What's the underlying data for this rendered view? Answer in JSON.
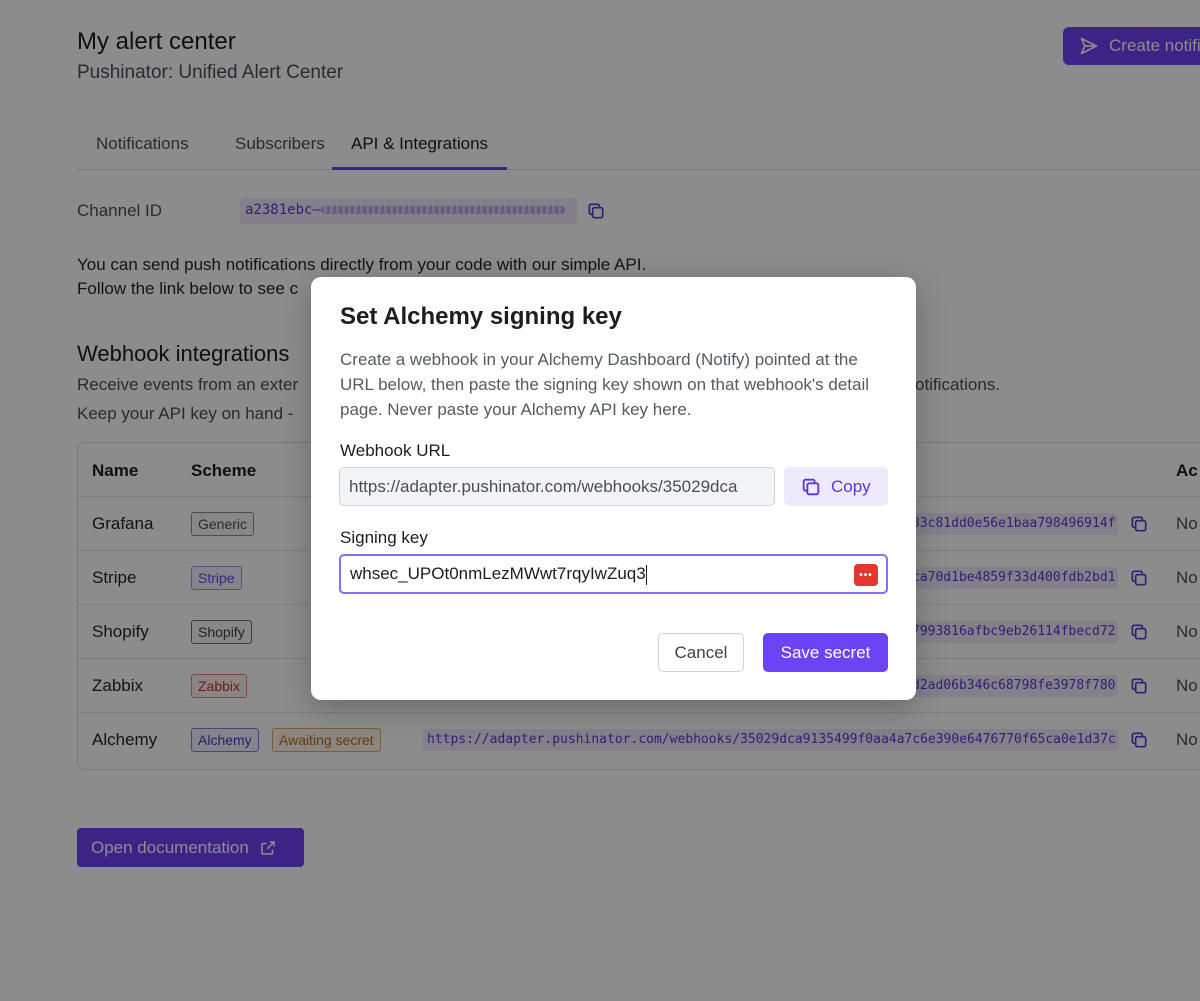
{
  "header": {
    "title": "My alert center",
    "subtitle": "Pushinator: Unified Alert Center",
    "create_button_label": "Create notification"
  },
  "tabs": [
    {
      "label": "Notifications",
      "active": false
    },
    {
      "label": "Subscribers",
      "active": false
    },
    {
      "label": "API & Integrations",
      "active": true
    }
  ],
  "channel": {
    "label": "Channel ID",
    "value_prefix": "a2381ebc–"
  },
  "api_description": {
    "line1": "You can send push notifications directly from your code with our simple API.",
    "line2": "Follow the link below to see c"
  },
  "webhooks": {
    "title": "Webhook integrations",
    "subtitle_start": "Receive events from an exter",
    "subtitle_end": "otifications.",
    "note": "Keep your API key on hand -",
    "columns": [
      "Name",
      "Scheme",
      "Ac"
    ],
    "rows": [
      {
        "name": "Grafana",
        "scheme": "Generic",
        "url": "33c81dd0e56e1baa798496914f",
        "action": "No"
      },
      {
        "name": "Stripe",
        "scheme": "Stripe",
        "url": "ca70d1be4859f33d400fdb2bd1",
        "action": "No"
      },
      {
        "name": "Shopify",
        "scheme": "Shopify",
        "url": "7993816afbc9eb26114fbecd72",
        "action": "No"
      },
      {
        "name": "Zabbix",
        "scheme": "Zabbix",
        "url": "d2ad06b346c68798fe3978f780",
        "action": "No"
      },
      {
        "name": "Alchemy",
        "scheme": "Alchemy",
        "extra_badge": "Awaiting secret",
        "url": "https://adapter.pushinator.com/webhooks/35029dca9135499f0aa4a7c6e390e6476770f65ca0e1d37c",
        "action": "No"
      }
    ]
  },
  "docs_button_label": "Open documentation",
  "colors": {
    "accent": "#6d43f6",
    "badge_generic": "#4a4f57",
    "badge_stripe": "#6d43f6",
    "badge_shopify": "#3c4048",
    "badge_zabbix": "#c0392b",
    "badge_alchemy": "#3f3fb8",
    "badge_awaiting": "#b86a1b"
  },
  "modal": {
    "title": "Set Alchemy signing key",
    "description": "Create a webhook in your Alchemy Dashboard (Notify) pointed at the URL below, then paste the signing key shown on that webhook's detail page. Never paste your Alchemy API key here.",
    "webhook_url_label": "Webhook URL",
    "webhook_url_value": "https://adapter.pushinator.com/webhooks/35029dca",
    "copy_label": "Copy",
    "signing_key_label": "Signing key",
    "signing_key_value": "whsec_UPOt0nmLezMWwt7rqyIwZuq3",
    "cancel_label": "Cancel",
    "save_label": "Save secret"
  }
}
